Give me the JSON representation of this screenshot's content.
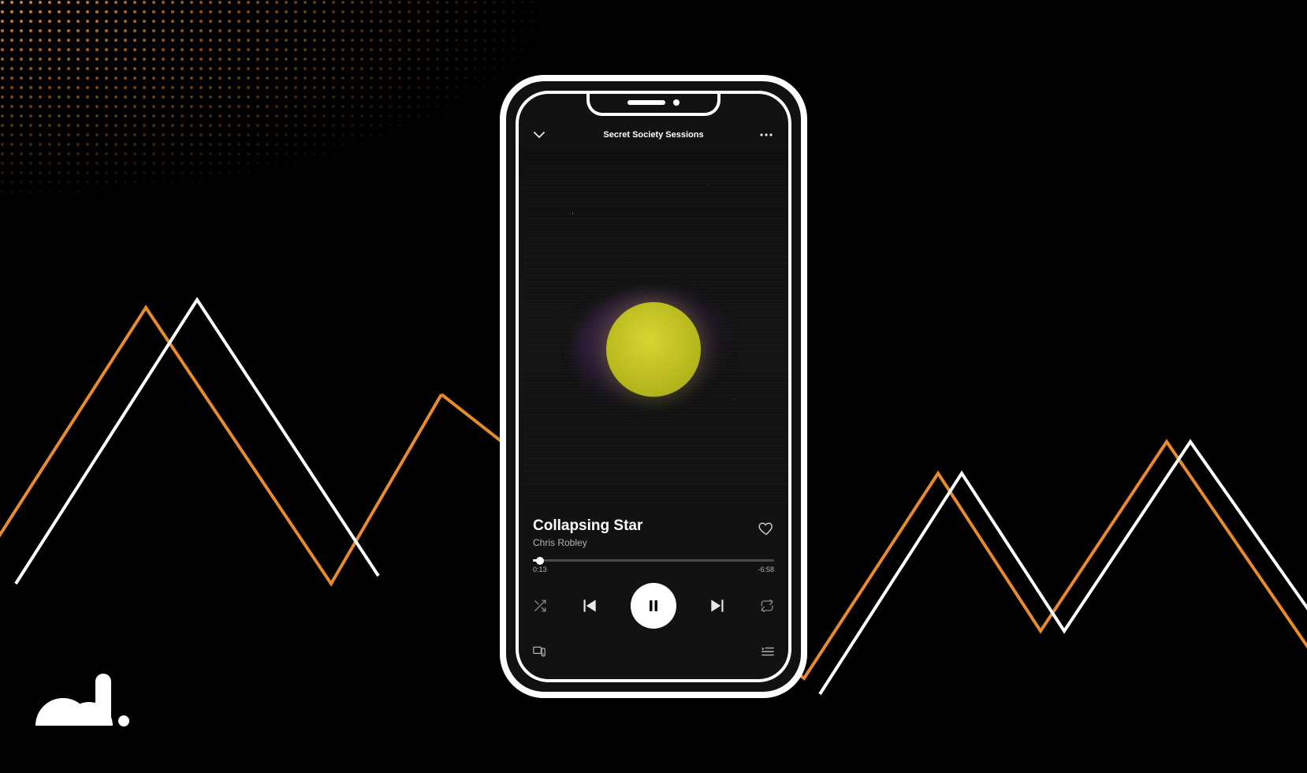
{
  "colors": {
    "accent": "#e88b2e",
    "bg": "#121212",
    "text_muted": "#b3b3b3"
  },
  "player": {
    "context_title": "Secret Society Sessions",
    "track_title": "Collapsing Star",
    "artist": "Chris Robley",
    "elapsed": "0:13",
    "remaining": "-6:58",
    "progress_pct": 3.0,
    "icons": {
      "down": "chevron-down-icon",
      "more": "more-icon",
      "heart": "heart-icon",
      "shuffle": "shuffle-icon",
      "prev": "previous-track-icon",
      "playpause": "pause-icon",
      "next": "next-track-icon",
      "repeat": "repeat-icon",
      "devices": "devices-icon",
      "queue": "queue-icon"
    }
  }
}
